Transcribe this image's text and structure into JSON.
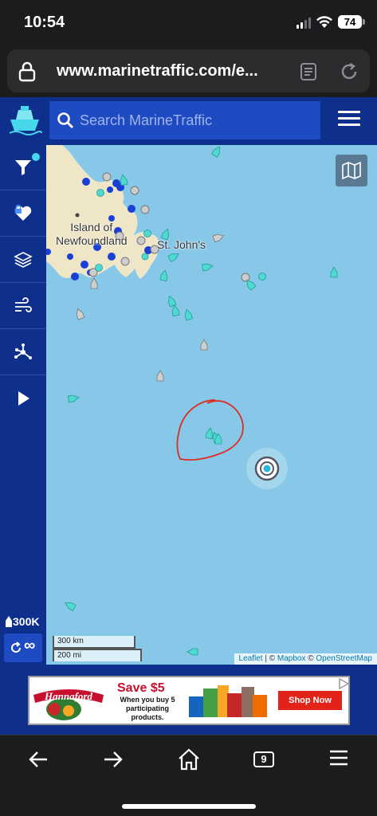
{
  "status_bar": {
    "time": "10:54",
    "battery": "74"
  },
  "browser": {
    "url": "www.marinetraffic.com/e..."
  },
  "header": {
    "search_placeholder": "Search MarineTraffic"
  },
  "sidebar": {
    "items": [
      {
        "name": "filter",
        "icon": "filter-icon"
      },
      {
        "name": "favourites",
        "icon": "heart-icon"
      },
      {
        "name": "layers",
        "icon": "layers-icon"
      },
      {
        "name": "weather",
        "icon": "wind-icon"
      },
      {
        "name": "routes",
        "icon": "network-icon"
      },
      {
        "name": "playback",
        "icon": "play-icon"
      }
    ],
    "vessel_count": "300K",
    "refresh_label": "∞"
  },
  "map": {
    "labels": {
      "island": "Island of\nNewfoundland",
      "city": "St. John's"
    },
    "scale_km": "300 km",
    "scale_mi": "200 mi",
    "attribution": {
      "leaflet": "Leaflet",
      "sep": " | © ",
      "mapbox": "Mapbox",
      "sep2": " © ",
      "osm": "OpenStreetMap"
    },
    "colors": {
      "ocean": "#87c8e8",
      "land": "#efe6c8",
      "vessel": "#4fd9d0",
      "annotation": "#e02b20"
    }
  },
  "ad": {
    "brand": "Hannaford",
    "headline": "Save $5",
    "body": "When you buy 5 participating products.",
    "cta": "Shop Now"
  },
  "toolbar": {
    "tabs": "9"
  }
}
